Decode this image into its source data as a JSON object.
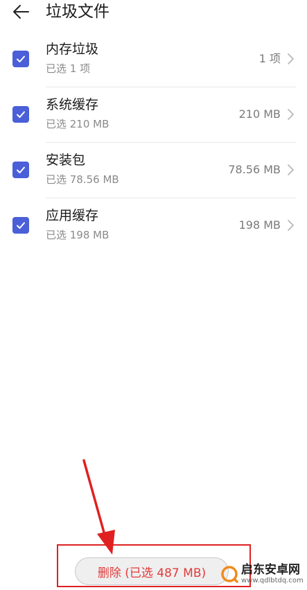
{
  "header": {
    "title": "垃圾文件"
  },
  "items": [
    {
      "title": "内存垃圾",
      "subtitle": "已选 1 项",
      "value": "1 项"
    },
    {
      "title": "系统缓存",
      "subtitle": "已选 210 MB",
      "value": "210 MB"
    },
    {
      "title": "安装包",
      "subtitle": "已选 78.56 MB",
      "value": "78.56 MB"
    },
    {
      "title": "应用缓存",
      "subtitle": "已选 198 MB",
      "value": "198 MB"
    }
  ],
  "footer": {
    "delete_label": "删除 (已选 487 MB)"
  },
  "watermark": {
    "name": "启东安卓网",
    "url": "www.qdlbtdq.com"
  },
  "colors": {
    "accent": "#4a5fd8",
    "danger": "#e23a3a",
    "annotation": "#e02020"
  }
}
